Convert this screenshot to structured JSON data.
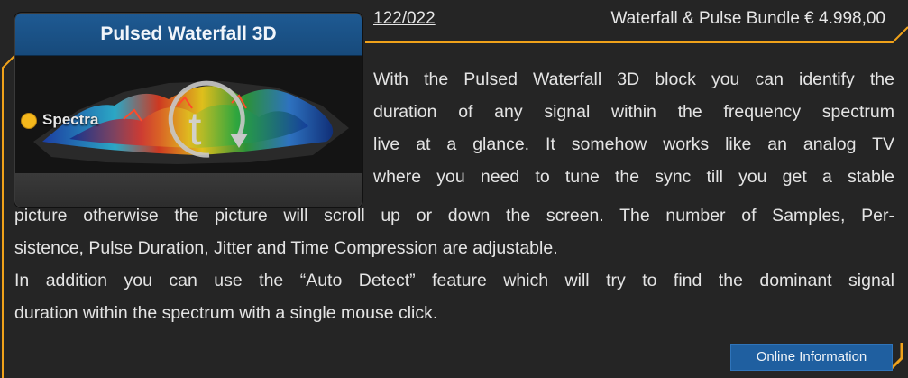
{
  "block": {
    "title": "Pulsed Waterfall 3D",
    "port_label": "Spectra",
    "port_color": "#f5b81c",
    "header_color": "#1e5a93"
  },
  "header": {
    "article_number": "122/022",
    "bundle_price": "Waterfall & Pulse Bundle € 4.998,00"
  },
  "description": {
    "lines": [
      "With the Pulsed Waterfall 3D block you can identify the",
      "duration of any signal within the frequency spectrum",
      "live at a glance. It somehow works like an analog TV",
      "where you need to tune the sync till you get a stable",
      "picture otherwise the picture will scroll up or down the screen. The number of Samples, Per-",
      "sistence, Pulse Duration, Jitter and Time Compression are adjustable.",
      "In addition you can use the “Auto Detect” feature which will try to find the dominant signal",
      "duration within the spectrum with a single mouse click."
    ]
  },
  "online_button": {
    "label": "Online Information"
  },
  "accent_color": "#f0a21a"
}
